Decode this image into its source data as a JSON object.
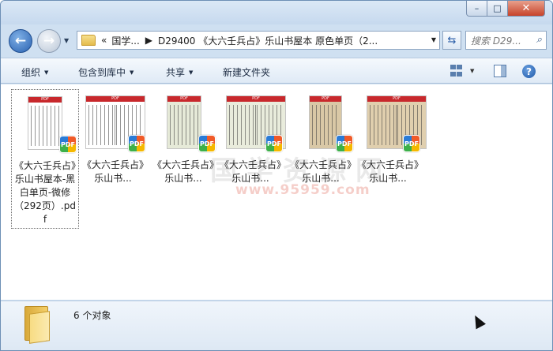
{
  "window": {
    "controls": {
      "minimize": "–",
      "maximize": "□",
      "close": "✕"
    }
  },
  "nav": {
    "back_icon": "arrow-left-icon",
    "forward_icon": "arrow-right-icon",
    "address": {
      "prefix": "«",
      "crumbs": [
        "国学...",
        "D29400 《大六壬兵占》乐山书屋本 原色单页（2..."
      ]
    },
    "search_placeholder": "搜索 D29...",
    "refresh_icon": "refresh-icon"
  },
  "toolbar": {
    "organize": "组织",
    "include_library": "包含到库中",
    "share": "共享",
    "new_folder": "新建文件夹",
    "help": "?"
  },
  "files": [
    {
      "label": "《大六壬兵占》乐山书屋本-黑白单页-微修（292页）.pdf",
      "selected": true,
      "tone": "#ffffff",
      "split": false,
      "badge": "PDF"
    },
    {
      "label": "《大六壬兵占》乐山书...",
      "selected": false,
      "tone": "#ffffff",
      "split": true,
      "badge": "PDF"
    },
    {
      "label": "《大六壬兵占》乐山书...",
      "selected": false,
      "tone": "#e6ead8",
      "split": false,
      "badge": "PDF"
    },
    {
      "label": "《大六壬兵占》乐山书...",
      "selected": false,
      "tone": "#e9ecdc",
      "split": true,
      "badge": "PDF"
    },
    {
      "label": "《大六壬兵占》乐山书...",
      "selected": false,
      "tone": "#d9c8a6",
      "split": false,
      "badge": "PDF"
    },
    {
      "label": "《大六壬兵占》乐山书...",
      "selected": false,
      "tone": "#e0cfae",
      "split": true,
      "badge": "PDF"
    }
  ],
  "thumb_header": "PDF",
  "watermark": {
    "line1": "国学资源网",
    "line2": "www.95959.com"
  },
  "status": {
    "count": "6 个对象"
  }
}
